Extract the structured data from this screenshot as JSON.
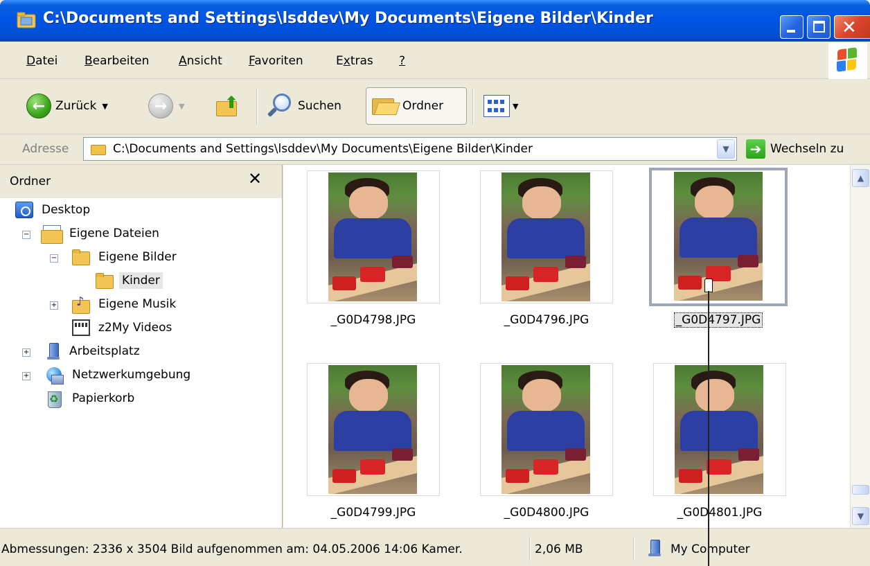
{
  "window": {
    "title": "C:\\Documents and Settings\\lsddev\\My Documents\\Eigene Bilder\\Kinder"
  },
  "menu": [
    {
      "pre": "",
      "u": "D",
      "post": "atei"
    },
    {
      "pre": "",
      "u": "B",
      "post": "earbeiten"
    },
    {
      "pre": "",
      "u": "A",
      "post": "nsicht"
    },
    {
      "pre": "",
      "u": "F",
      "post": "avoriten"
    },
    {
      "pre": "E",
      "u": "x",
      "post": "tras"
    },
    {
      "pre": "",
      "u": "?",
      "post": ""
    }
  ],
  "toolbar": {
    "back_label": "Zurück",
    "search_label": "Suchen",
    "folders_label": "Ordner"
  },
  "address": {
    "label": "Adresse",
    "value": "C:\\Documents and Settings\\lsddev\\My Documents\\Eigene Bilder\\Kinder",
    "go_label": "Wechseln zu"
  },
  "folder_pane": {
    "title": "Ordner",
    "tree": [
      {
        "label": "Desktop",
        "icon": "desktop-icon"
      },
      {
        "label": "Eigene Dateien",
        "icon": "documents-icon"
      },
      {
        "label": "Eigene Bilder",
        "icon": "folder-icon"
      },
      {
        "label": "Kinder",
        "icon": "folder-icon",
        "selected": true
      },
      {
        "label": "Eigene Musik",
        "icon": "music-folder-icon"
      },
      {
        "label": "z2My Videos",
        "icon": "video-folder-icon"
      },
      {
        "label": "Arbeitsplatz",
        "icon": "computer-icon"
      },
      {
        "label": "Netzwerkumgebung",
        "icon": "network-icon"
      },
      {
        "label": "Papierkorb",
        "icon": "recycle-bin-icon"
      }
    ]
  },
  "files": [
    {
      "name": "_G0D4798.JPG"
    },
    {
      "name": "_G0D4796.JPG"
    },
    {
      "name": "_G0D4797.JPG",
      "selected": true
    },
    {
      "name": "_G0D4799.JPG"
    },
    {
      "name": "_G0D4800.JPG"
    },
    {
      "name": "_G0D4801.JPG"
    }
  ],
  "status": {
    "details": "Abmessungen: 2336 x 3504 Bild aufgenommen am: 04.05.2006 14:06 Kamer.",
    "size": "2,06 MB",
    "zone": "My Computer"
  },
  "colors": {
    "titlebar": "#0054e3",
    "chrome": "#ece9d8",
    "selection_border": "#9fa6b8"
  }
}
